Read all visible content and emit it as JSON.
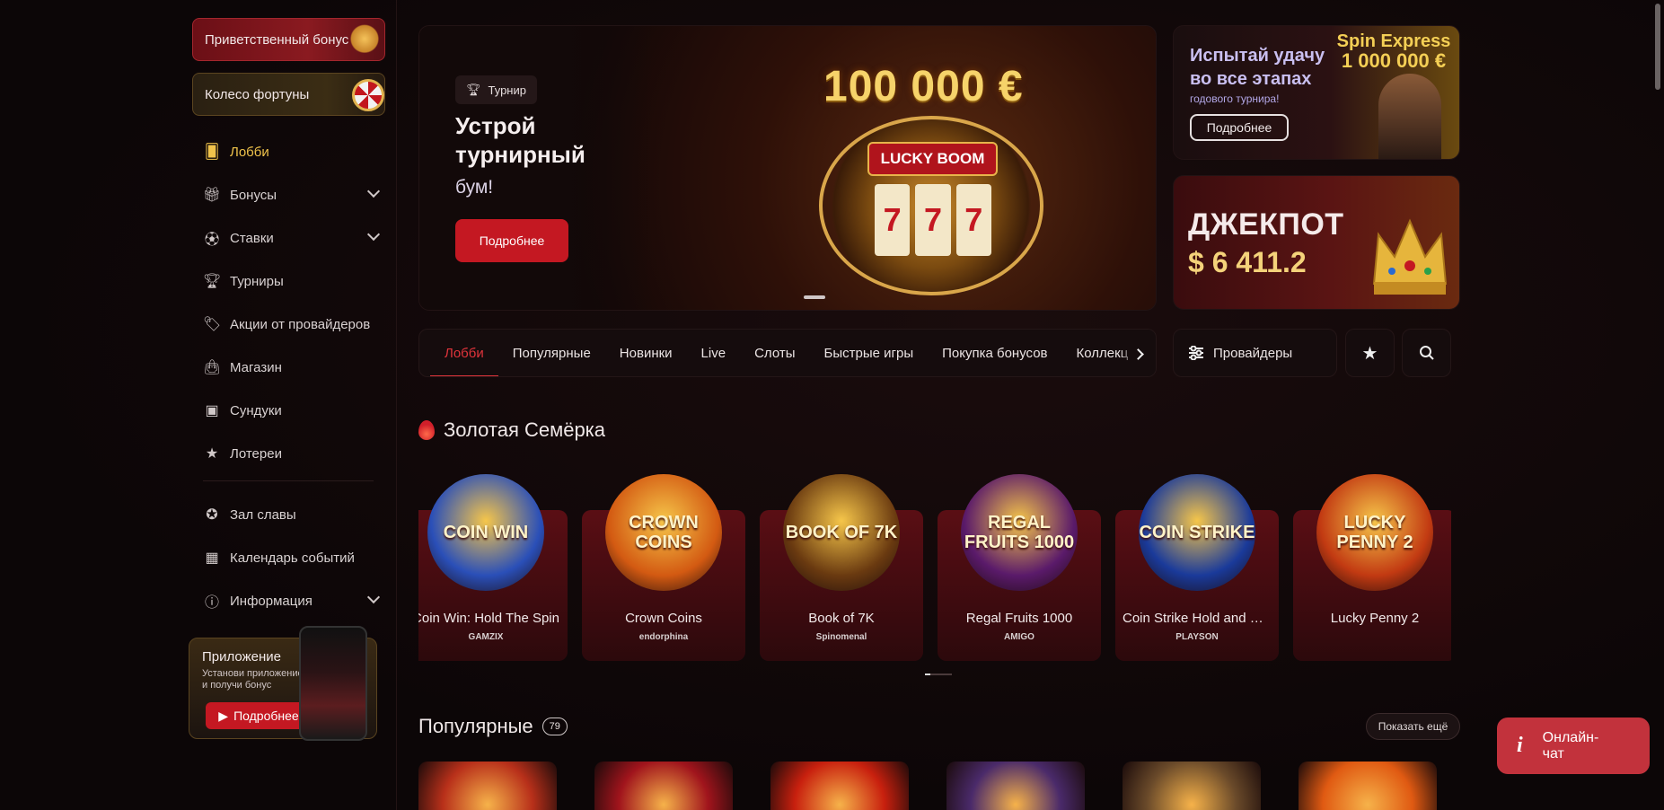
{
  "sidebar": {
    "welcome_bonus": "Приветственный бонус",
    "fortune_wheel": "Колесо фортуны",
    "items": [
      {
        "label": "Лобби",
        "icon": "lobby-icon",
        "active": true
      },
      {
        "label": "Бонусы",
        "icon": "gift-icon",
        "expandable": true
      },
      {
        "label": "Ставки",
        "icon": "soccer-ball-icon",
        "expandable": true
      },
      {
        "label": "Турниры",
        "icon": "trophy-icon"
      },
      {
        "label": "Акции от провайдеров",
        "icon": "tag-icon"
      },
      {
        "label": "Магазин",
        "icon": "shopping-bag-icon"
      },
      {
        "label": "Сундуки",
        "icon": "chest-icon"
      },
      {
        "label": "Лотереи",
        "icon": "lottery-ticket-icon"
      }
    ],
    "items2": [
      {
        "label": "Зал славы",
        "icon": "medal-icon"
      },
      {
        "label": "Календарь событий",
        "icon": "calendar-icon"
      },
      {
        "label": "Информация",
        "icon": "info-icon",
        "expandable": true
      }
    ],
    "app": {
      "title": "Приложение",
      "subtitle": "Установи приложение и получи бонус",
      "button": "Подробнее"
    }
  },
  "hero": {
    "tag": "Турнир",
    "title": "Устрой турнирный",
    "subtitle": "бум!",
    "button": "Подробнее",
    "amount": "100 000 €",
    "slot_brand": "LUCKY BOOM",
    "reels": [
      "7",
      "7",
      "7"
    ]
  },
  "promo_tournament": {
    "title": "Испытай удачу во все этапах",
    "subtitle": "годового турнира!",
    "button": "Подробнее",
    "brand": "Spin Express",
    "prize": "1 000 000 €"
  },
  "jackpot": {
    "title": "ДЖЕКПОТ",
    "amount": "$ 6 411.2"
  },
  "tabs": [
    "Лобби",
    "Популярные",
    "Новинки",
    "Live",
    "Слоты",
    "Быстрые игры",
    "Покупка бонусов",
    "Коллекц"
  ],
  "providers_button": "Провайдеры",
  "golden_seven": {
    "title": "Золотая Семёрка",
    "games": [
      {
        "name": "Coin Win: Hold The Spin",
        "provider": "GAMZIX",
        "art": "COIN WIN",
        "color": "#2a4fb8"
      },
      {
        "name": "Crown Coins",
        "provider": "endorphina",
        "art": "CROWN COINS",
        "color": "#d35a12"
      },
      {
        "name": "Book of 7K",
        "provider": "Spinomenal",
        "art": "BOOK OF 7K",
        "color": "#6a3a10"
      },
      {
        "name": "Regal Fruits 1000",
        "provider": "AMIGO",
        "art": "REGAL FRUITS 1000",
        "color": "#5a1a6a"
      },
      {
        "name": "Coin Strike Hold and Win",
        "provider": "PLAYSON",
        "art": "COIN STRIKE",
        "color": "#1a3a9a"
      },
      {
        "name": "Lucky Penny 2",
        "provider": "",
        "art": "LUCKY PENNY 2",
        "color": "#c23a12"
      }
    ]
  },
  "popular": {
    "title": "Популярные",
    "count": "79",
    "show_more": "Показать ещё",
    "thumb_colors": [
      "#b8301a",
      "#a0141c",
      "#c8200e",
      "#4a2a6a",
      "#6a4a2a",
      "#e05a12"
    ]
  },
  "chat": {
    "label": "Онлайн-чат"
  }
}
